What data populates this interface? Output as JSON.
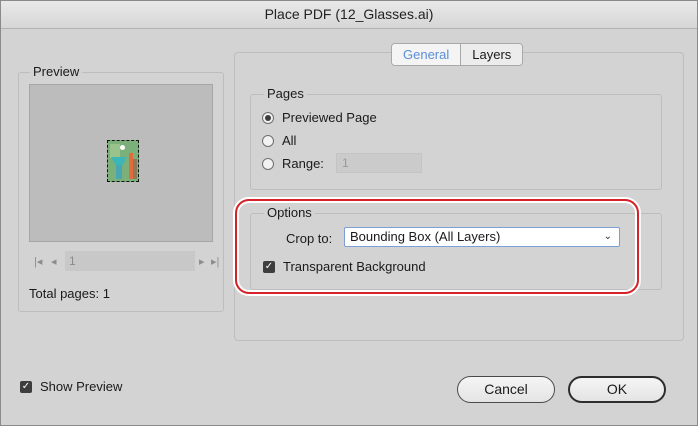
{
  "dialog": {
    "title": "Place PDF (12_Glasses.ai)"
  },
  "preview": {
    "label": "Preview",
    "nav": {
      "first_icon": "first-page-icon",
      "prev_icon": "previous-page-icon",
      "next_icon": "next-page-icon",
      "last_icon": "last-page-icon",
      "page_value": "1"
    },
    "total_pages": "Total pages: 1"
  },
  "tabs": [
    {
      "label": "General",
      "active": true
    },
    {
      "label": "Layers",
      "active": false
    }
  ],
  "pages": {
    "label": "Pages",
    "options": [
      {
        "label": "Previewed Page",
        "selected": true
      },
      {
        "label": "All",
        "selected": false
      },
      {
        "label": "Range:",
        "selected": false
      }
    ],
    "range_value": "1"
  },
  "options": {
    "label": "Options",
    "crop_label": "Crop to:",
    "crop_value": "Bounding Box (All Layers)",
    "transparent_background": {
      "label": "Transparent Background",
      "checked": true
    }
  },
  "show_preview": {
    "label": "Show Preview",
    "checked": true
  },
  "buttons": {
    "cancel": "Cancel",
    "ok": "OK"
  },
  "colors": {
    "highlight": "#d6232a",
    "active_tab": "#5a8ed8",
    "dialog_bg": "#d3d3d3"
  }
}
